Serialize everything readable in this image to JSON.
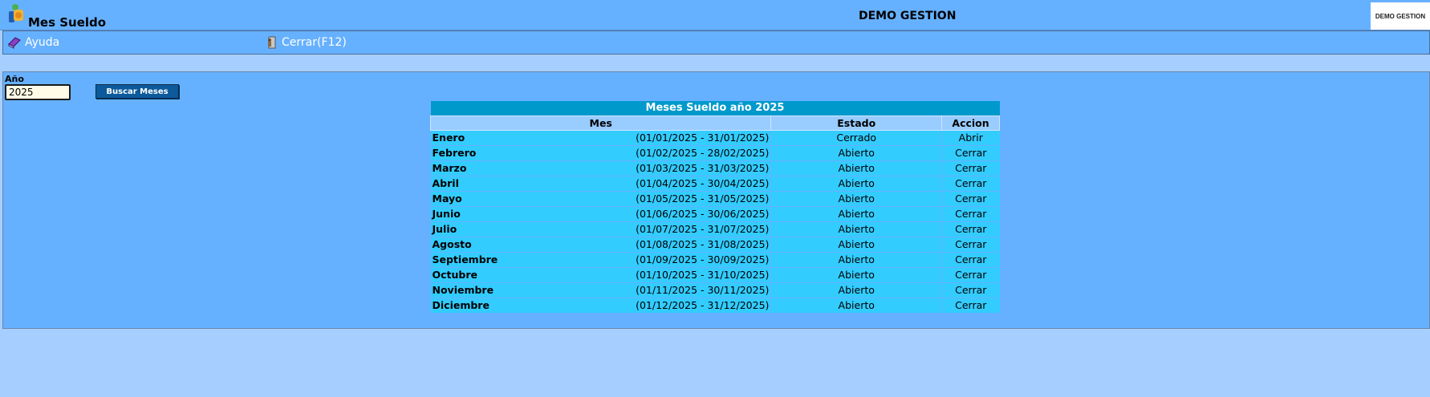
{
  "header": {
    "title": "Mes Sueldo",
    "company": "DEMO GESTION",
    "logo_text": "DEMO GESTION"
  },
  "menu": {
    "help_label": "Ayuda",
    "close_label": "Cerrar(F12)"
  },
  "filter": {
    "year_label": "Año",
    "year_value": "2025",
    "search_label": "Buscar Meses"
  },
  "table": {
    "caption": "Meses Sueldo año 2025",
    "columns": [
      "Mes",
      "Estado",
      "Accion"
    ],
    "rows": [
      {
        "mes": "Enero",
        "rango": "(01/01/2025 - 31/01/2025)",
        "estado": "Cerrado",
        "accion": "Abrir"
      },
      {
        "mes": "Febrero",
        "rango": "(01/02/2025 - 28/02/2025)",
        "estado": "Abierto",
        "accion": "Cerrar"
      },
      {
        "mes": "Marzo",
        "rango": "(01/03/2025 - 31/03/2025)",
        "estado": "Abierto",
        "accion": "Cerrar"
      },
      {
        "mes": "Abril",
        "rango": "(01/04/2025 - 30/04/2025)",
        "estado": "Abierto",
        "accion": "Cerrar"
      },
      {
        "mes": "Mayo",
        "rango": "(01/05/2025 - 31/05/2025)",
        "estado": "Abierto",
        "accion": "Cerrar"
      },
      {
        "mes": "Junio",
        "rango": "(01/06/2025 - 30/06/2025)",
        "estado": "Abierto",
        "accion": "Cerrar"
      },
      {
        "mes": "Julio",
        "rango": "(01/07/2025 - 31/07/2025)",
        "estado": "Abierto",
        "accion": "Cerrar"
      },
      {
        "mes": "Agosto",
        "rango": "(01/08/2025 - 31/08/2025)",
        "estado": "Abierto",
        "accion": "Cerrar"
      },
      {
        "mes": "Septiembre",
        "rango": "(01/09/2025 - 30/09/2025)",
        "estado": "Abierto",
        "accion": "Cerrar"
      },
      {
        "mes": "Octubre",
        "rango": "(01/10/2025 - 31/10/2025)",
        "estado": "Abierto",
        "accion": "Cerrar"
      },
      {
        "mes": "Noviembre",
        "rango": "(01/11/2025 - 30/11/2025)",
        "estado": "Abierto",
        "accion": "Cerrar"
      },
      {
        "mes": "Diciembre",
        "rango": "(01/12/2025 - 31/12/2025)",
        "estado": "Abierto",
        "accion": "Cerrar"
      }
    ]
  },
  "colors": {
    "bar": "#66b1ff",
    "background": "#a6cfff",
    "row": "#33ccff",
    "caption": "#0099cc",
    "header": "#99ccff",
    "button": "#0c5a9c"
  },
  "icons": {
    "app": "payroll-app-icon",
    "help": "help-book-icon",
    "close": "exit-door-icon"
  }
}
